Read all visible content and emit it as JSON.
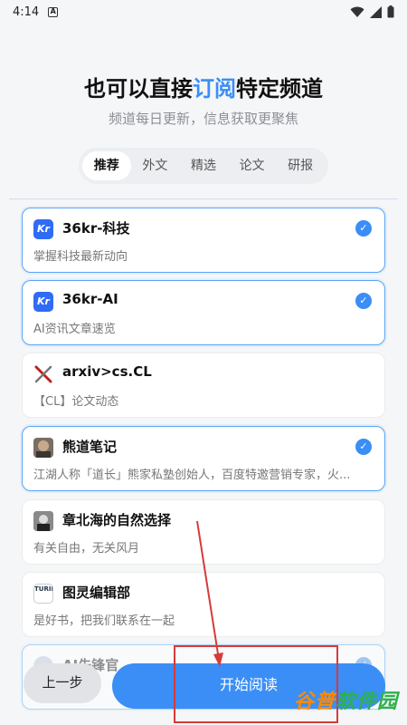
{
  "status": {
    "time": "4:14",
    "a_icon_letter": "A"
  },
  "header": {
    "title_pre": "也可以直接",
    "title_highlight": "订阅",
    "title_post": "特定频道",
    "subtitle": "频道每日更新，信息获取更聚焦",
    "highlight_color": "#3b8ef5"
  },
  "tabs": [
    {
      "label": "推荐",
      "active": true
    },
    {
      "label": "外文"
    },
    {
      "label": "精选"
    },
    {
      "label": "论文"
    },
    {
      "label": "研报"
    }
  ],
  "channels": [
    {
      "name": "36kr-科技",
      "desc": "掌握科技最新动向",
      "selected": true,
      "logo": "36kr-logo",
      "logo_text": "Kr"
    },
    {
      "name": "36kr-AI",
      "desc": "AI资讯文章速览",
      "selected": true,
      "logo": "36kr-logo",
      "logo_text": "Kr"
    },
    {
      "name": "arxiv>cs.CL",
      "desc": "【CL】论文动态",
      "selected": false,
      "logo": "arxiv-logo"
    },
    {
      "name": "熊道笔记",
      "desc": "江湖人称「道长」熊家私塾创始人，百度特邀营销专家，火...",
      "selected": true,
      "logo": "avatar-bear"
    },
    {
      "name": "章北海的自然选择",
      "desc": "有关自由，无关风月",
      "selected": false,
      "logo": "avatar-zhang"
    },
    {
      "name": "图灵编辑部",
      "desc": "是好书，把我们联系在一起",
      "selected": false,
      "logo": "turing-logo",
      "logo_text": "TURING"
    },
    {
      "name": "AI先锋官",
      "desc": "",
      "selected": true,
      "logo": "avatar-ai"
    }
  ],
  "buttons": {
    "back": "上一步",
    "start": "开始阅读"
  },
  "watermark": {
    "part1": "谷普",
    "part2": "软件园"
  }
}
